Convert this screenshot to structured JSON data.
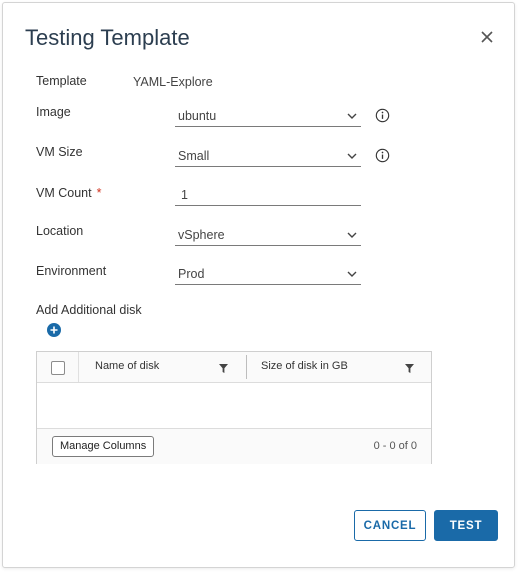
{
  "dialog": {
    "title": "Testing Template",
    "close_icon": "close-icon"
  },
  "form": {
    "template": {
      "label": "Template",
      "value": "YAML-Explore"
    },
    "image": {
      "label": "Image",
      "value": "ubuntu",
      "icon": "chevron-down-icon",
      "info_icon": "info-icon"
    },
    "vm_size": {
      "label": "VM Size",
      "value": "Small",
      "icon": "chevron-down-icon",
      "info_icon": "info-icon"
    },
    "vm_count": {
      "label": "VM Count",
      "required_mark": "*",
      "value": "1"
    },
    "location": {
      "label": "Location",
      "value": "vSphere",
      "icon": "chevron-down-icon"
    },
    "environment": {
      "label": "Environment",
      "value": "Prod",
      "icon": "chevron-down-icon"
    }
  },
  "disks": {
    "label": "Add Additional disk",
    "add_icon": "plus-circle-icon",
    "columns": [
      "Name of disk",
      "Size of disk in GB"
    ],
    "filter_icon": "filter-icon",
    "rows": [],
    "manage_columns_label": "Manage Columns",
    "pagination": "0 - 0 of 0"
  },
  "actions": {
    "cancel_label": "CANCEL",
    "test_label": "TEST"
  },
  "colors": {
    "primary": "#1a6aa8",
    "required": "#d0311d"
  }
}
